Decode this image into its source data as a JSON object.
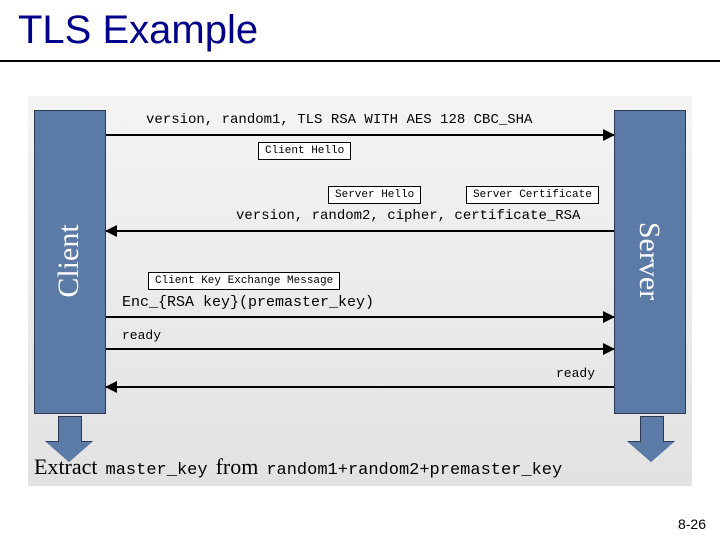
{
  "title": "TLS Example",
  "page_number": "8-26",
  "actors": {
    "client": "Client",
    "server": "Server"
  },
  "msg1": {
    "text": "version, random1, TLS RSA WITH AES 128 CBC_SHA",
    "label": "Client Hello"
  },
  "msg2": {
    "label_hello": "Server Hello",
    "label_cert": "Server Certificate",
    "text": "version, random2, cipher, certificate_RSA"
  },
  "msg3": {
    "label": "Client Key Exchange Message",
    "text": "Enc_{RSA key}(premaster_key)"
  },
  "msg4": {
    "text": "ready"
  },
  "msg5": {
    "text": "ready"
  },
  "extract": {
    "word_extract": "Extract",
    "word_from": "from",
    "master": "master_key",
    "inputs": "random1+random2+premaster_key"
  }
}
